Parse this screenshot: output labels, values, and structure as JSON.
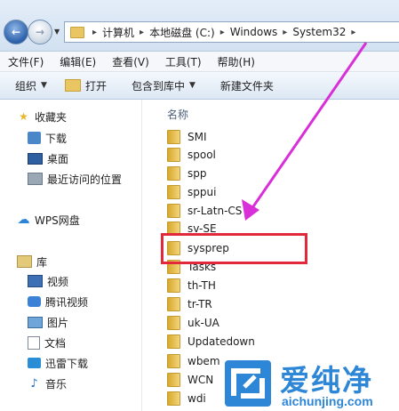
{
  "address": {
    "crumbs": [
      "计算机",
      "本地磁盘 (C:)",
      "Windows",
      "System32"
    ]
  },
  "menu": [
    "文件(F)",
    "编辑(E)",
    "查看(V)",
    "工具(T)",
    "帮助(H)"
  ],
  "toolbar": {
    "organize": "组织",
    "open": "打开",
    "include": "包含到库中",
    "new_folder": "新建文件夹"
  },
  "nav": {
    "favorites": "收藏夹",
    "downloads": "下载",
    "desktop": "桌面",
    "recent": "最近访问的位置",
    "wps": "WPS网盘",
    "library": "库",
    "video": "视频",
    "tencent_video": "腾讯视频",
    "pictures": "图片",
    "documents": "文档",
    "xunlei": "迅雷下载",
    "music": "音乐"
  },
  "files": {
    "column_name": "名称",
    "items": [
      "SMI",
      "spool",
      "spp",
      "sppui",
      "sr-Latn-CS",
      "sv-SE",
      "sysprep",
      "Tasks",
      "th-TH",
      "tr-TR",
      "uk-UA",
      "Updatedown",
      "wbem",
      "WCN",
      "wdi"
    ]
  },
  "watermark": {
    "brand": "爱纯净",
    "url": "aichunjing.com"
  },
  "colors": {
    "highlight": "#e2283b",
    "arrow": "#d82fd8",
    "brand": "#2d86d6"
  }
}
